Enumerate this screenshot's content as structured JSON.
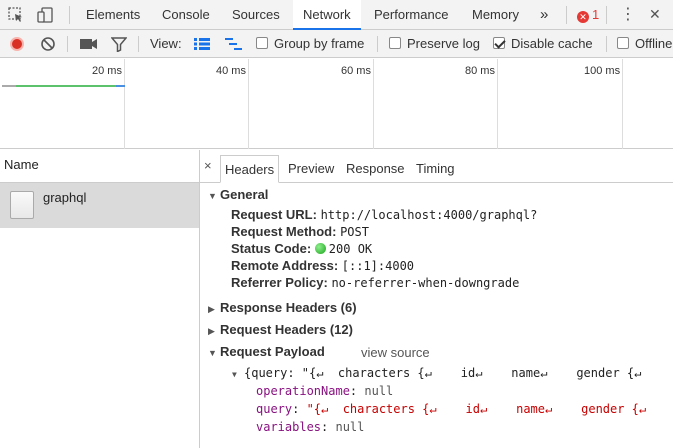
{
  "tabbar": {
    "tabs": [
      "Elements",
      "Console",
      "Sources",
      "Network",
      "Performance",
      "Memory"
    ],
    "active": "Network",
    "more": "»",
    "error_count": "1",
    "kebab": "⋮",
    "close": "✕"
  },
  "toolbar": {
    "view_label": "View:",
    "group_by_frame": "Group by frame",
    "preserve_log": "Preserve log",
    "disable_cache": "Disable cache",
    "offline": "Offline"
  },
  "overview": {
    "ticks": [
      "20 ms",
      "40 ms",
      "60 ms",
      "80 ms",
      "100 ms"
    ]
  },
  "requests": {
    "header": "Name",
    "items": [
      {
        "name": "graphql"
      }
    ]
  },
  "details": {
    "close": "×",
    "tabs": [
      "Headers",
      "Preview",
      "Response",
      "Timing"
    ],
    "general": {
      "title": "General",
      "request_url_label": "Request URL:",
      "request_url": "http://localhost:4000/graphql?",
      "method_label": "Request Method:",
      "method": "POST",
      "status_label": "Status Code:",
      "status": "200 OK",
      "remote_label": "Remote Address:",
      "remote": "[::1]:4000",
      "referrer_label": "Referrer Policy:",
      "referrer": "no-referrer-when-downgrade"
    },
    "response_headers": "Response Headers (6)",
    "request_headers": "Request Headers (12)",
    "payload": {
      "title": "Request Payload",
      "view_source": "view source",
      "summary": "{query: \"{↵  characters {↵    id↵    name↵    gender {↵      name↵    }↵  }↵}\"",
      "operation_key": "operationName",
      "operation_val": "null",
      "query_key": "query",
      "query_val": "\"{↵  characters {↵    id↵    name↵    gender {↵",
      "variables_key": "variables",
      "variables_val": "null"
    }
  }
}
